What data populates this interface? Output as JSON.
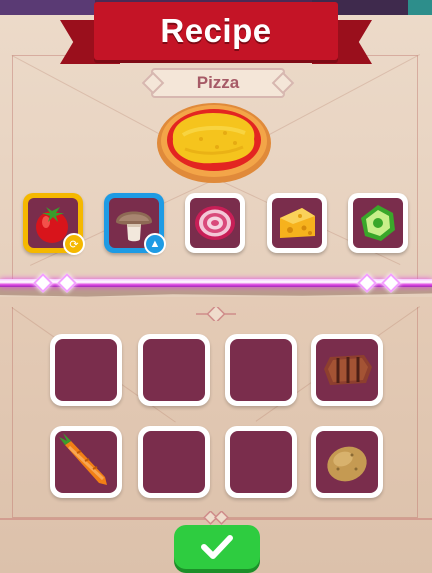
{
  "screen": {
    "title": "Recipe",
    "recipe_name": "Pizza"
  },
  "ingredients": [
    {
      "icon": "tomato-icon",
      "frame": "yellow",
      "badge": "chop-icon"
    },
    {
      "icon": "mushroom-icon",
      "frame": "blue",
      "badge": "flame-icon"
    },
    {
      "icon": "onion-icon",
      "frame": "white"
    },
    {
      "icon": "cheese-icon",
      "frame": "white"
    },
    {
      "icon": "pepper-icon",
      "frame": "white"
    }
  ],
  "dish_slots": [
    {
      "item": null
    },
    {
      "item": null
    },
    {
      "item": null
    },
    {
      "item": "grilled-meat-icon"
    },
    {
      "item": "carrot-icon"
    },
    {
      "item": null
    },
    {
      "item": null
    },
    {
      "item": "potato-icon"
    }
  ],
  "colors": {
    "banner": "#c41426",
    "slot_fill": "#7a2d4c",
    "highlight_yellow": "#f5b800",
    "highlight_blue": "#1e9be4",
    "confirm": "#2ecc40",
    "laser": "#e04ae4"
  },
  "actions": {
    "confirm_icon": "checkmark-icon"
  }
}
